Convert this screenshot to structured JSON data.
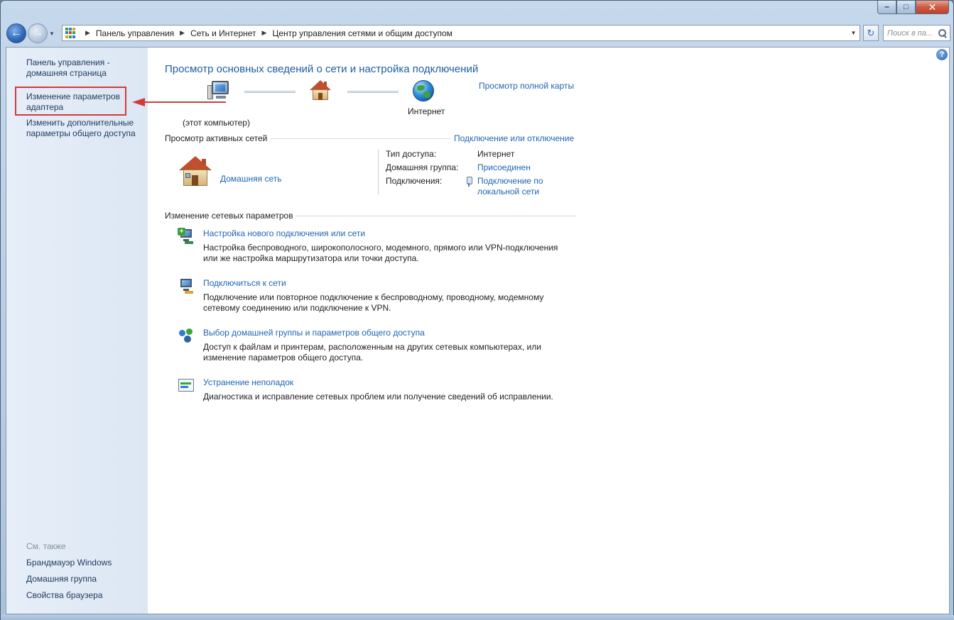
{
  "window": {
    "caption": {
      "minimize": "‒",
      "maximize": "□",
      "close": "✕"
    }
  },
  "navbar": {
    "back_glyph": "←",
    "forward_glyph": "→",
    "breadcrumb": [
      "Панель управления",
      "Сеть и Интернет",
      "Центр управления сетями и общим доступом"
    ],
    "search_placeholder": "Поиск в па...",
    "refresh_glyph": "↻",
    "dropdown_glyph": "▼"
  },
  "sidebar": {
    "links": [
      "Панель управления -",
      "домашняя страница",
      "Изменение параметров",
      "адаптера",
      "Изменить дополнительные",
      "параметры общего доступа"
    ],
    "see_also_heading": "См. также",
    "see_also": [
      "Брандмауэр Windows",
      "Домашняя группа",
      "Свойства браузера"
    ]
  },
  "main": {
    "help_glyph": "?",
    "title": "Просмотр основных сведений о сети и настройка подключений",
    "full_map_link": "Просмотр полной карты",
    "map": {
      "computer_label": "(этот компьютер)",
      "internet_label": "Интернет"
    },
    "active_networks": {
      "heading": "Просмотр активных сетей",
      "connect_link": "Подключение или отключение",
      "network_name": "Домашняя сеть",
      "props": [
        {
          "label": "Тип доступа:",
          "value": "Интернет"
        },
        {
          "label": "Домашняя группа:",
          "value": "Присоединен"
        },
        {
          "label": "Подключения:",
          "value_line1": "Подключение по",
          "value_line2": "локальной сети"
        }
      ]
    },
    "change_settings": {
      "heading": "Изменение сетевых параметров",
      "tasks": [
        {
          "title": "Настройка нового подключения или сети",
          "desc1": "Настройка беспроводного, широкополосного, модемного, прямого или VPN-подключения",
          "desc2": "или же настройка маршрутизатора или точки доступа."
        },
        {
          "title": "Подключиться к сети",
          "desc1": "Подключение или повторное подключение к беспроводному, проводному, модемному",
          "desc2": "сетевому соединению или подключение к VPN."
        },
        {
          "title": "Выбор домашней группы и параметров общего доступа",
          "desc1": "Доступ к файлам и принтерам, расположенным на других сетевых компьютерах, или",
          "desc2": "изменение параметров общего доступа."
        },
        {
          "title": "Устранение неполадок",
          "desc1": "Диагностика и исправление сетевых проблем или получение сведений об исправлении.",
          "desc2": ""
        }
      ]
    }
  },
  "colors": {
    "link": "#1d66b3",
    "title": "#1e5e9e",
    "annotation": "#d33a3a"
  }
}
